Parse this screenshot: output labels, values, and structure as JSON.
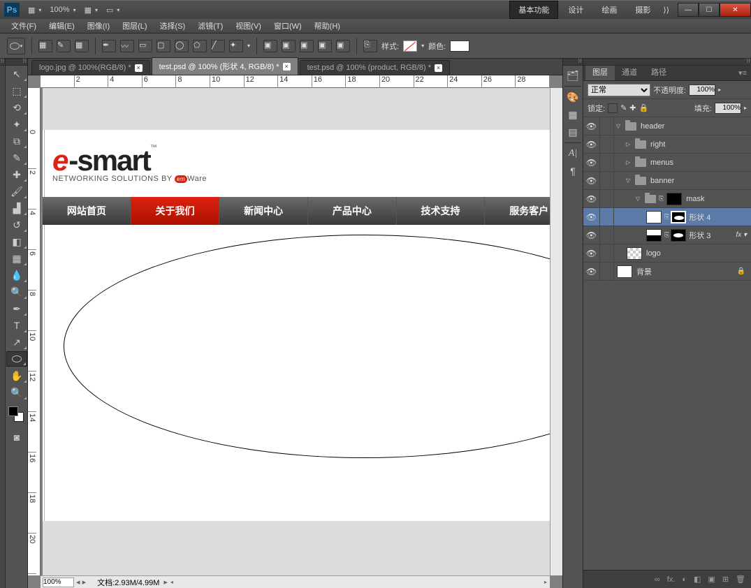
{
  "titlebar": {
    "ps": "Ps",
    "zoom": "100%"
  },
  "workspace_switcher": {
    "items": [
      "基本功能",
      "设计",
      "绘画",
      "摄影"
    ],
    "active": 0
  },
  "menus": [
    "文件(F)",
    "编辑(E)",
    "图像(I)",
    "图层(L)",
    "选择(S)",
    "滤镜(T)",
    "视图(V)",
    "窗口(W)",
    "帮助(H)"
  ],
  "optionbar": {
    "style_label": "样式:",
    "color_label": "颜色:"
  },
  "tabs": [
    {
      "label": "logo.jpg @ 100%(RGB/8) *"
    },
    {
      "label": "test.psd @ 100% (形状 4, RGB/8) *",
      "active": true
    },
    {
      "label": "test.psd @ 100% (product, RGB/8) *"
    }
  ],
  "ruler_h": [
    "",
    "2",
    "4",
    "6",
    "8",
    "10",
    "12",
    "14",
    "16",
    "18",
    "20",
    "22",
    "24",
    "26",
    "28"
  ],
  "ruler_v": [
    "",
    "0",
    "2",
    "4",
    "6",
    "8",
    "10",
    "12",
    "14",
    "16",
    "18",
    "20"
  ],
  "nav": [
    "网站首页",
    "关于我们",
    "新闻中心",
    "产品中心",
    "技术支持",
    "服务客户"
  ],
  "nav_active": 1,
  "logo": {
    "e": "e",
    "smart": "-smart",
    "tm": "™",
    "sub": "NETWORKING SOLUTIONS BY ",
    "em": "em",
    "ware": "Ware"
  },
  "statusbar": {
    "zoom": "100%",
    "doc": "文档:2.93M/4.99M"
  },
  "panel": {
    "tabs": [
      "图层",
      "通道",
      "路径"
    ],
    "blend": "正常",
    "opacity_label": "不透明度:",
    "opacity": "100%",
    "lock_label": "锁定:",
    "fill_label": "填充:",
    "fill": "100%"
  },
  "layers": [
    {
      "type": "group",
      "name": "header",
      "depth": 0,
      "open": true
    },
    {
      "type": "group",
      "name": "right",
      "depth": 1,
      "open": false
    },
    {
      "type": "group",
      "name": "menus",
      "depth": 1,
      "open": false
    },
    {
      "type": "group",
      "name": "banner",
      "depth": 1,
      "open": true
    },
    {
      "type": "group",
      "name": "mask",
      "depth": 2,
      "open": true,
      "mask": true
    },
    {
      "type": "shape",
      "name": "形状 4",
      "depth": 3,
      "mask": true,
      "selected": true
    },
    {
      "type": "shape",
      "name": "形状 3",
      "depth": 3,
      "fx": true
    },
    {
      "type": "layer",
      "name": "logo",
      "depth": 1,
      "transparent": true
    },
    {
      "type": "bg",
      "name": "背景",
      "depth": 0,
      "locked": true
    }
  ],
  "panel_bottom": [
    "∞",
    "fx.",
    "◐",
    "◧",
    "▣",
    "⊞",
    "🗑"
  ]
}
